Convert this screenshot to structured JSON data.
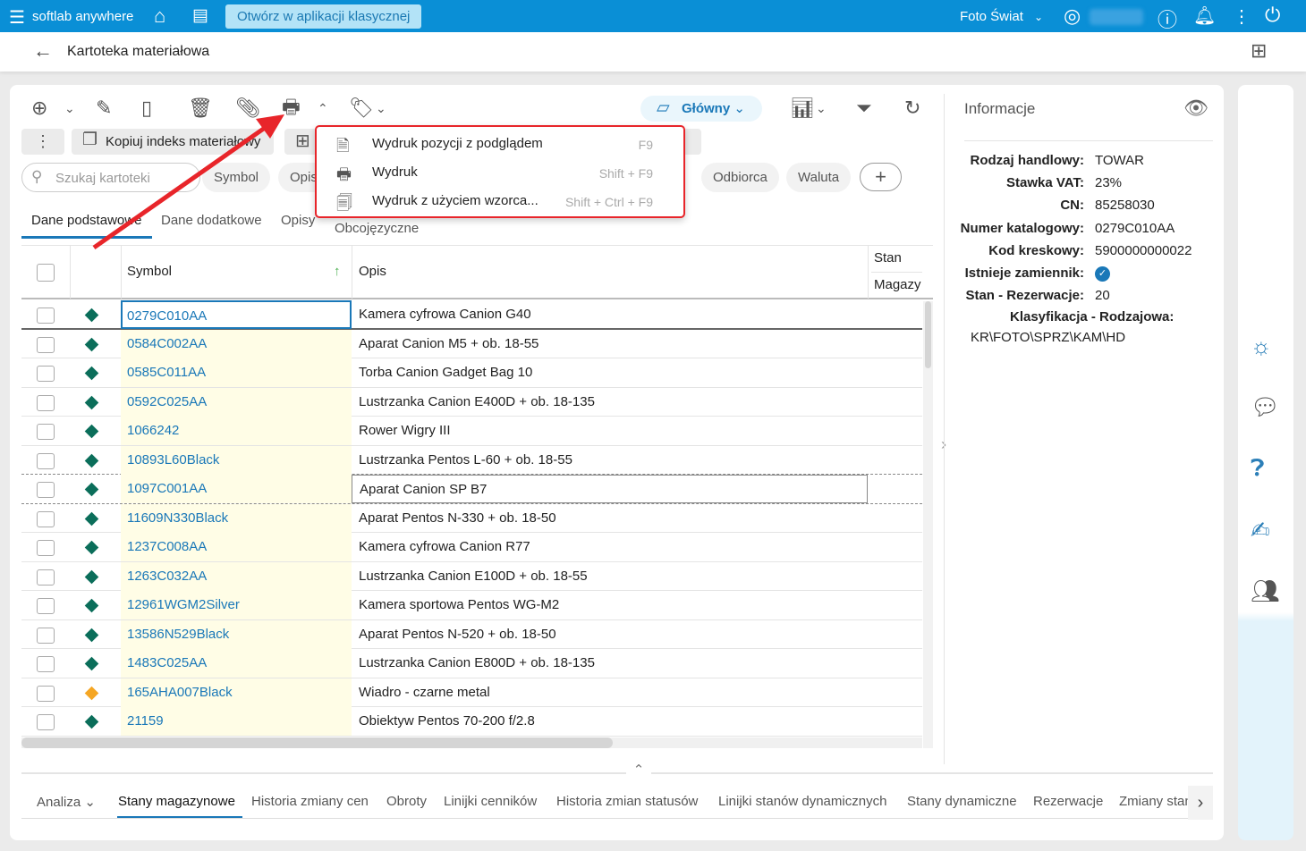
{
  "topbar": {
    "app_name": "softlab anywhere",
    "open_classic": "Otwórz w aplikacji klasycznej",
    "company": "Foto Świat"
  },
  "header": {
    "title": "Kartoteka materiałowa"
  },
  "toolbar": {
    "view_label": "Główny",
    "copy_index": "Kopiuj indeks materiałowy"
  },
  "print_menu": [
    {
      "label": "Wydruk pozycji z podglądem",
      "shortcut": "F9",
      "icon": "print-preview-icon"
    },
    {
      "label": "Wydruk",
      "shortcut": "Shift + F9",
      "icon": "printer-icon"
    },
    {
      "label": "Wydruk z użyciem wzorca...",
      "shortcut": "Shift + Ctrl + F9",
      "icon": "print-template-icon"
    }
  ],
  "search": {
    "placeholder": "Szukaj kartoteki"
  },
  "filter_chips": [
    "Symbol",
    "Opis",
    "Odbiorca",
    "Waluta"
  ],
  "tabs": [
    "Dane podstawowe",
    "Dane dodatkowe",
    "Opisy",
    "Obcojęzyczne"
  ],
  "table": {
    "headers": {
      "symbol": "Symbol",
      "opis": "Opis",
      "stan": "Stan",
      "magazyn": "Magazy"
    },
    "rows": [
      {
        "symbol": "0279C010AA",
        "opis": "Kamera cyfrowa Canion G40",
        "status": "green"
      },
      {
        "symbol": "0584C002AA",
        "opis": "Aparat Canion M5 + ob. 18-55",
        "status": "green"
      },
      {
        "symbol": "0585C011AA",
        "opis": "Torba Canion Gadget Bag 10",
        "status": "green"
      },
      {
        "symbol": "0592C025AA",
        "opis": "Lustrzanka Canion E400D + ob. 18-135",
        "status": "green"
      },
      {
        "symbol": "1066242",
        "opis": "Rower Wigry III",
        "status": "green"
      },
      {
        "symbol": "10893L60Black",
        "opis": "Lustrzanka Pentos L-60 + ob. 18-55",
        "status": "green"
      },
      {
        "symbol": "1097C001AA",
        "opis": "Aparat Canion SP B7",
        "status": "green"
      },
      {
        "symbol": "11609N330Black",
        "opis": "Aparat Pentos N-330 + ob. 18-50",
        "status": "green"
      },
      {
        "symbol": "1237C008AA",
        "opis": "Kamera cyfrowa Canion R77",
        "status": "green"
      },
      {
        "symbol": "1263C032AA",
        "opis": "Lustrzanka Canion E100D + ob. 18-55",
        "status": "green"
      },
      {
        "symbol": "12961WGM2Silver",
        "opis": "Kamera sportowa Pentos WG-M2",
        "status": "green"
      },
      {
        "symbol": "13586N529Black",
        "opis": "Aparat Pentos N-520 + ob. 18-50",
        "status": "green"
      },
      {
        "symbol": "1483C025AA",
        "opis": "Lustrzanka Canion E800D + ob. 18-135",
        "status": "green"
      },
      {
        "symbol": "165AHA007Black",
        "opis": "Wiadro - czarne metal",
        "status": "orange"
      },
      {
        "symbol": "21159",
        "opis": "Obiektyw Pentos 70-200 f/2.8",
        "status": "green"
      }
    ]
  },
  "info": {
    "title": "Informacje",
    "fields": [
      {
        "k": "Rodzaj handlowy:",
        "v": "TOWAR"
      },
      {
        "k": "Stawka VAT:",
        "v": "23%"
      },
      {
        "k": "CN:",
        "v": "85258030"
      },
      {
        "k": "Numer katalogowy:",
        "v": "0279C010AA"
      },
      {
        "k": "Kod kreskowy:",
        "v": "5900000000022"
      },
      {
        "k": "Istnieje zamiennik:",
        "v": ""
      },
      {
        "k": "Stan - Rezerwacje:",
        "v": "20"
      }
    ],
    "class_label": "Klasyfikacja - Rodzajowa:",
    "class_value": "KR\\FOTO\\SPRZ\\KAM\\HD"
  },
  "bottom_tabs": {
    "analiza": "Analiza",
    "items": [
      "Stany magazynowe",
      "Historia zmiany cen",
      "Obroty",
      "Linijki cenników",
      "Historia zmian statusów",
      "Linijki stanów dynamicznych",
      "Stany dynamiczne",
      "Rezerwacje",
      "Zmiany stanów"
    ]
  },
  "colors": {
    "brand": "#0a8fd6",
    "green": "#0b6e5a",
    "orange": "#f5a623",
    "annotation": "#e8252a"
  }
}
